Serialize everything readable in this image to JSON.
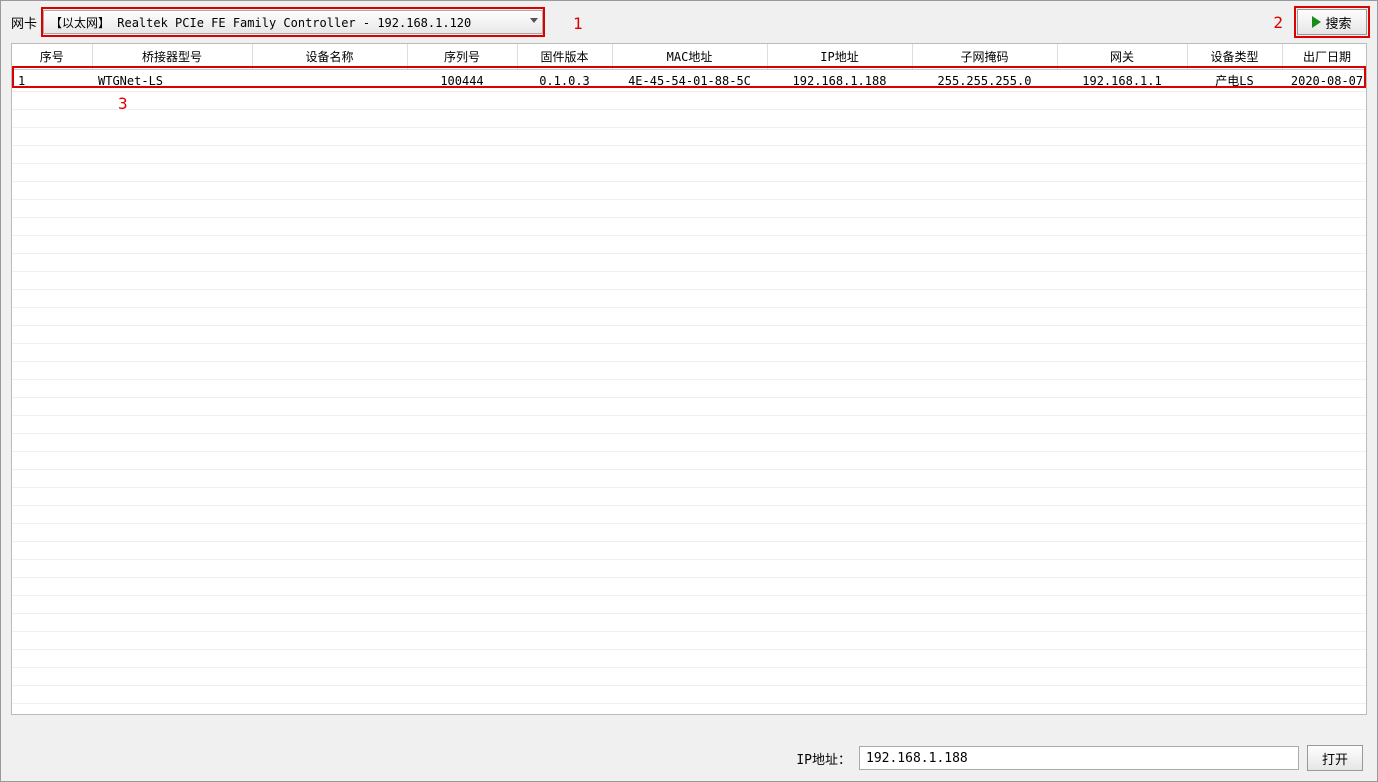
{
  "topbar": {
    "nic_label": "网卡",
    "nic_value": "【以太网】 Realtek PCIe FE Family Controller - 192.168.1.120",
    "search_label": "搜索"
  },
  "annotations": {
    "one": "1",
    "two": "2",
    "three": "3"
  },
  "table": {
    "headers": [
      "序号",
      "桥接器型号",
      "设备名称",
      "序列号",
      "固件版本",
      "MAC地址",
      "IP地址",
      "子网掩码",
      "网关",
      "设备类型",
      "出厂日期"
    ],
    "rows": [
      {
        "index": "1",
        "model": "WTGNet-LS",
        "device_name": "",
        "serial": "100444",
        "firmware": "0.1.0.3",
        "mac": "4E-45-54-01-88-5C",
        "ip": "192.168.1.188",
        "mask": "255.255.255.0",
        "gateway": "192.168.1.1",
        "type": "产电LS",
        "date": "2020-08-07"
      }
    ]
  },
  "bottom": {
    "ip_label": "IP地址：",
    "ip_value": "192.168.1.188",
    "open_label": "打开"
  }
}
